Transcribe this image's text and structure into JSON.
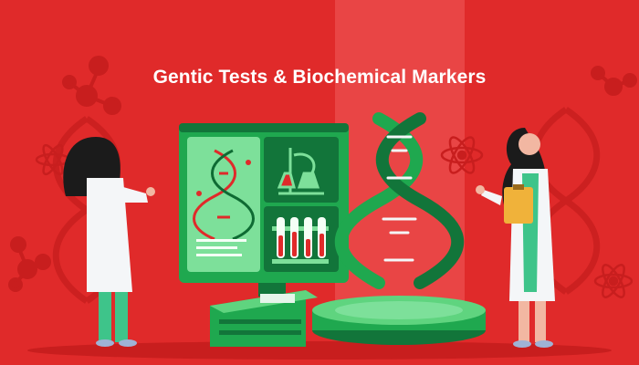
{
  "banner": {
    "title": "Gentic Tests & Biochemical Markers"
  },
  "palette": {
    "background": "#e02a2a",
    "background_shadow": "#c81e1e",
    "monitor_green": "#1fa84f",
    "screen_green": "#5fd47f",
    "dark_green": "#12753a",
    "coat_white": "#f4f6f8",
    "hair": "#1b1b1b",
    "skin": "#f2b7a2",
    "pants": "#3ec48a"
  },
  "icons": [
    "dna-helix-icon",
    "atom-icon",
    "molecule-icon",
    "test-tubes-icon",
    "flask-icon",
    "clipboard-icon"
  ]
}
